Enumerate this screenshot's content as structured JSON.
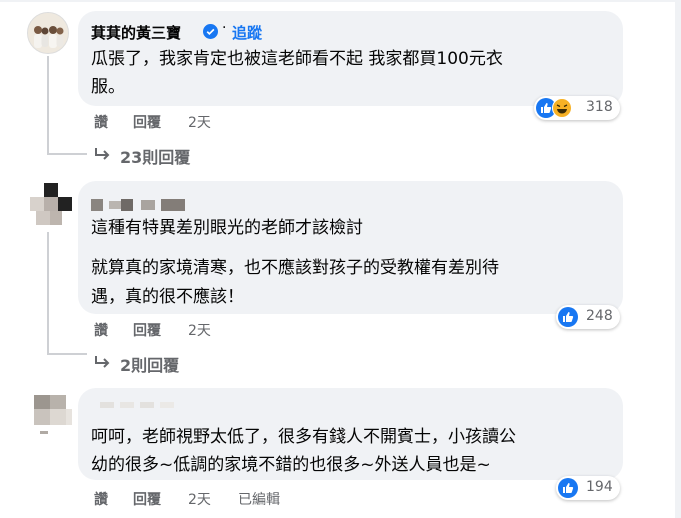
{
  "comments": [
    {
      "author": "萁萁的黃三寶",
      "follow_label": "追蹤",
      "lines": [
        "瓜張了，我家肯定也被這老師看不起 我家都買100元衣",
        "服。"
      ],
      "reaction_count": "318",
      "actions": {
        "like": "讚",
        "reply": "回覆",
        "time": "2天"
      },
      "replies_label": "23則回覆"
    },
    {
      "lines": [
        "這種有特異差別眼光的老師才該檢討",
        "就算真的家境清寒，也不應該對孩子的受教權有差別待",
        "遇，真的很不應該！"
      ],
      "reaction_count": "248",
      "actions": {
        "like": "讚",
        "reply": "回覆",
        "time": "2天"
      },
      "replies_label": "2則回覆"
    },
    {
      "lines": [
        "呵呵，老師視野太低了，很多有錢人不開賓士，小孩讀公",
        "幼的很多~低調的家境不錯的也很多~外送人員也是~"
      ],
      "reaction_count": "194",
      "actions": {
        "like": "讚",
        "reply": "回覆",
        "time": "2天",
        "edited": "已編輯"
      }
    }
  ],
  "colors": {
    "bubble": "#f0f2f5",
    "meta": "#65676b",
    "like": "#1877f2",
    "haha": "#f7b125"
  }
}
